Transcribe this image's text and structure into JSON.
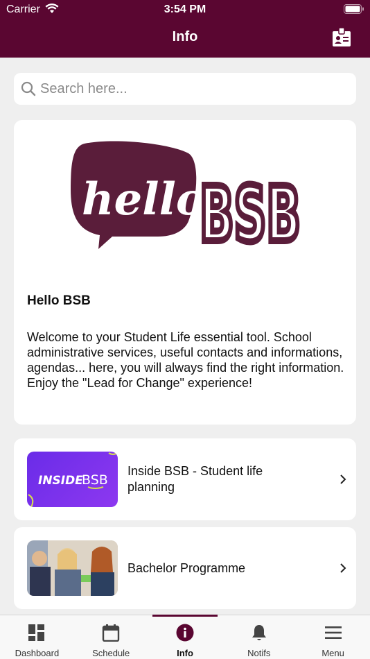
{
  "colors": {
    "brand": "#5a0631",
    "background": "#efefef",
    "card": "#ffffff"
  },
  "status_bar": {
    "carrier": "Carrier",
    "time": "3:54 PM"
  },
  "header": {
    "title": "Info",
    "action_icon": "id-card-icon"
  },
  "search": {
    "placeholder": "Search here..."
  },
  "hello_card": {
    "logo_text": "hello BSB",
    "title": "Hello BSB",
    "body": "Welcome to your Student Life essential tool. School administrative services, useful contacts and informations, agendas... here, you will always find the right information. Enjoy the \"Lead for Change\" experience!"
  },
  "items": [
    {
      "label": "Inside BSB - Student life planning",
      "thumb_text": "INSIDE BSB"
    },
    {
      "label": "Bachelor Programme"
    }
  ],
  "tabs": [
    {
      "label": "Dashboard",
      "icon": "dashboard-icon"
    },
    {
      "label": "Schedule",
      "icon": "calendar-icon"
    },
    {
      "label": "Info",
      "icon": "info-icon",
      "active": true
    },
    {
      "label": "Notifs",
      "icon": "bell-icon"
    },
    {
      "label": "Menu",
      "icon": "hamburger-icon"
    }
  ]
}
